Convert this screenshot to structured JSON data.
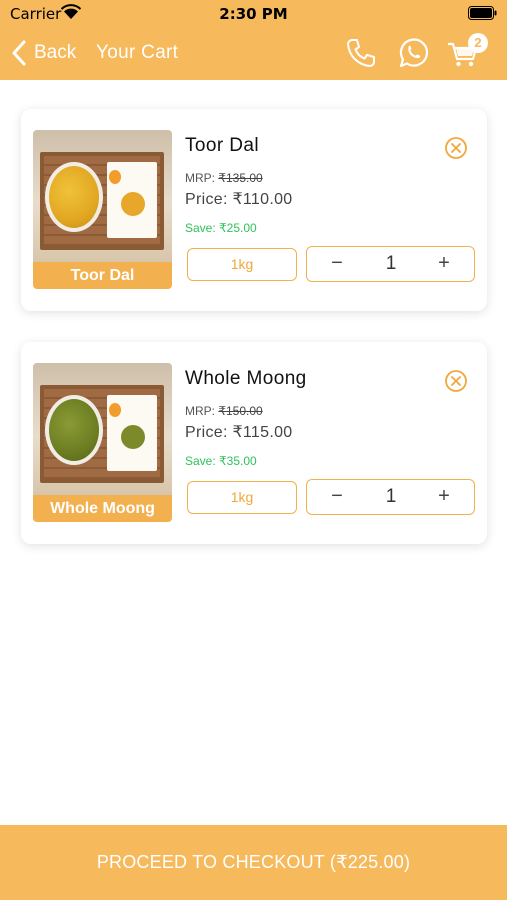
{
  "status_bar": {
    "carrier": "Carrier",
    "time": "2:30 PM"
  },
  "nav": {
    "back_label": "Back",
    "title": "Your Cart",
    "cart_count": "2",
    "accent_color": "#f6b95c",
    "icons": [
      "chevron-left-icon",
      "phone-icon",
      "whatsapp-icon",
      "cart-icon"
    ]
  },
  "cart": {
    "items": [
      {
        "name": "Toor Dal",
        "image_label": "Toor Dal",
        "mrp_label": "MRP:",
        "mrp_value": "₹135.00",
        "price": "Price: ₹110.00",
        "save": "Save: ₹25.00",
        "weight": "1kg",
        "quantity": "1"
      },
      {
        "name": "Whole Moong",
        "image_label": "Whole Moong",
        "mrp_label": "MRP:",
        "mrp_value": "₹150.00",
        "price": "Price: ₹115.00",
        "save": "Save: ₹35.00",
        "weight": "1kg",
        "quantity": "1"
      }
    ],
    "stepper": {
      "minus": "−",
      "plus": "+"
    }
  },
  "checkout": {
    "label": "PROCEED TO CHECKOUT (₹225.00)"
  }
}
